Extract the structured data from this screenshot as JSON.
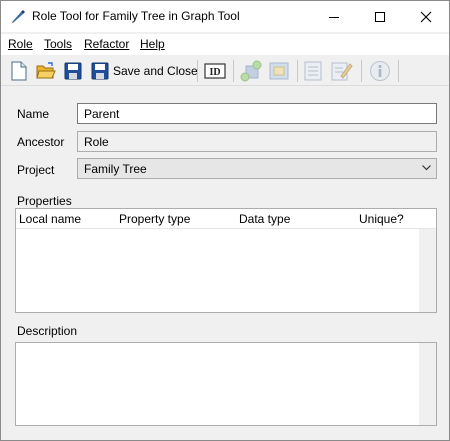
{
  "window": {
    "title": "Role Tool for Family Tree in Graph Tool",
    "controls": {
      "minimize_icon": "minimize-icon",
      "maximize_icon": "maximize-icon",
      "close_icon": "close-icon"
    }
  },
  "menu": {
    "items": [
      {
        "label": "Role",
        "hotkey_index": 0
      },
      {
        "label": "Tools",
        "hotkey_index": 0
      },
      {
        "label": "Refactor",
        "hotkey_index": 0
      },
      {
        "label": "Help",
        "hotkey_index": 0
      }
    ]
  },
  "toolbar": {
    "save_and_close_label": "Save and Close",
    "id_label": "ID",
    "icons": [
      "new-document-icon",
      "open-folder-icon",
      "save-icon",
      "save-and-close-icon",
      "id-icon",
      "add-node-icon",
      "edit-node-icon",
      "list-icon",
      "edit-list-icon",
      "info-icon"
    ]
  },
  "form": {
    "name_label": "Name",
    "name_value": "Parent",
    "ancestor_label": "Ancestor",
    "ancestor_value": "Role",
    "project_label": "Project",
    "project_value": "Family Tree"
  },
  "properties": {
    "label": "Properties",
    "columns": [
      "Local name",
      "Property type",
      "Data type",
      "Unique?"
    ],
    "rows": []
  },
  "description": {
    "label": "Description",
    "value": ""
  },
  "colors": {
    "window_bg": "#f0f0f0",
    "titlebar_bg": "#ffffff",
    "border": "#adadad"
  }
}
